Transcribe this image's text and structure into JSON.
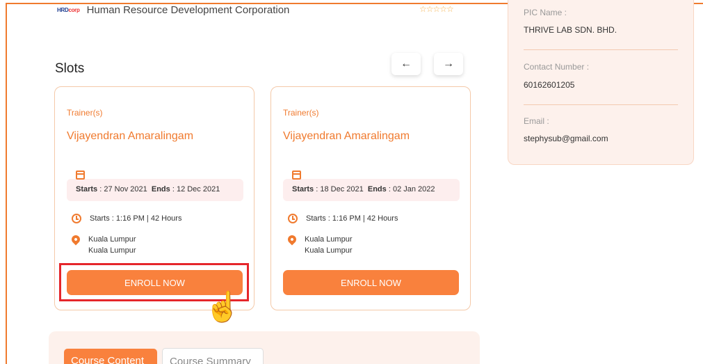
{
  "provider": {
    "logo_text": "HRD",
    "logo_suffix": "corp",
    "name": "Human Resource Development Corporation",
    "stars": "☆☆☆☆☆"
  },
  "slots": {
    "title": "Slots",
    "prev_icon": "arrow-left-icon",
    "next_icon": "arrow-right-icon",
    "prev_glyph": "←",
    "next_glyph": "→",
    "cards": [
      {
        "trainer_label": "Trainer(s)",
        "trainer_name": "Vijayendran Amaralingam",
        "starts_label": "Starts",
        "start_date": " : 27 Nov 2021",
        "ends_label": "Ends",
        "end_date": " : 12 Dec 2021",
        "time": "Starts : 1:16 PM | 42 Hours",
        "location_line1": "Kuala Lumpur",
        "location_line2": "Kuala Lumpur",
        "enroll_label": "ENROLL NOW"
      },
      {
        "trainer_label": "Trainer(s)",
        "trainer_name": "Vijayendran Amaralingam",
        "starts_label": "Starts",
        "start_date": " : 18 Dec 2021",
        "ends_label": "Ends",
        "end_date": " : 02 Jan 2022",
        "time": "Starts : 1:16 PM | 42 Hours",
        "location_line1": "Kuala Lumpur",
        "location_line2": "Kuala Lumpur",
        "enroll_label": "ENROLL NOW"
      }
    ]
  },
  "pic": {
    "name_label": "PIC Name :",
    "name_value": "THRIVE LAB SDN. BHD.",
    "contact_label": "Contact Number :",
    "contact_value": "60162601205",
    "email_label": "Email :",
    "email_value": "stephysub@gmail.com"
  },
  "tabs": {
    "content": "Course Content",
    "summary": "Course Summary"
  },
  "cursor_glyph": "☝",
  "colors": {
    "accent": "#f9813d",
    "highlight": "#e5262b",
    "panel_bg": "#fdf1ec"
  }
}
